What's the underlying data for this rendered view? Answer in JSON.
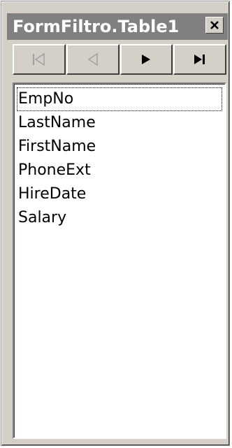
{
  "window": {
    "title": "FormFiltro.Table1"
  },
  "titlebar": {
    "close_icon": "close-icon"
  },
  "navigator": {
    "buttons": [
      {
        "name": "first",
        "icon": "first-record-icon",
        "enabled": false
      },
      {
        "name": "prior",
        "icon": "prior-record-icon",
        "enabled": false
      },
      {
        "name": "next",
        "icon": "next-record-icon",
        "enabled": true
      },
      {
        "name": "last",
        "icon": "last-record-icon",
        "enabled": true
      }
    ]
  },
  "fields": {
    "items": [
      "EmpNo",
      "LastName",
      "FirstName",
      "PhoneExt",
      "HireDate",
      "Salary"
    ],
    "focused_index": 0
  },
  "colors": {
    "titlebar_bg": "#808080",
    "face": "#d4d0c8",
    "disabled_glyph": "#a0a0a0"
  }
}
